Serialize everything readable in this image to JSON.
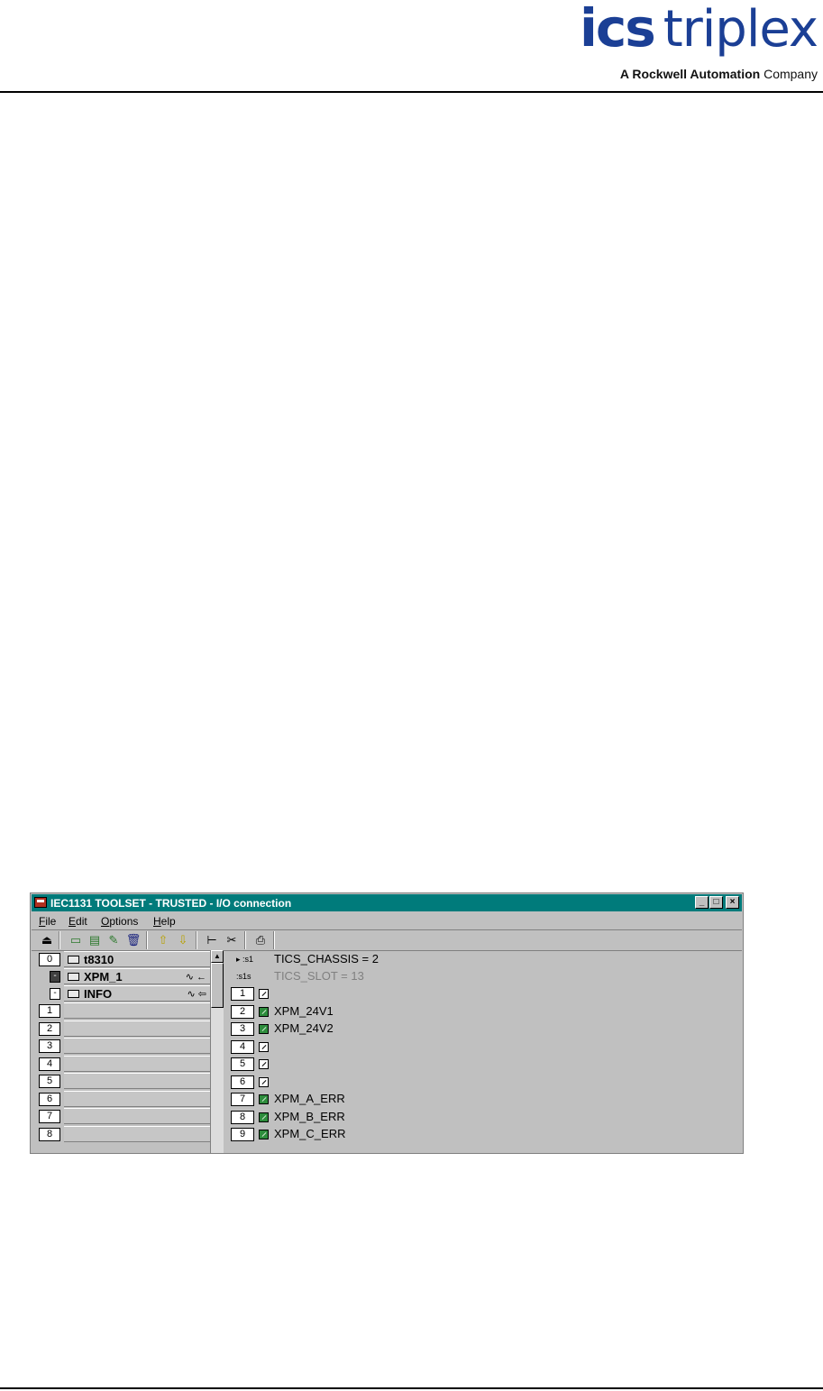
{
  "header": {
    "logo_ics": "ics",
    "logo_triplex": "triplex",
    "logo_subtitle_bold": "A Rockwell Automation",
    "logo_subtitle_normal": "Company",
    "brand_color": "#1b3f95"
  },
  "window": {
    "title": "IEC1131 TOOLSET - TRUSTED - I/O connection",
    "titlebar_color": "#007b7b",
    "controls": {
      "minimize": "_",
      "maximize": "□",
      "close": "×"
    }
  },
  "menu": {
    "items": [
      {
        "accel": "F",
        "rest": "ile"
      },
      {
        "accel": "E",
        "rest": "dit"
      },
      {
        "accel": "O",
        "rest": "ptions"
      },
      {
        "accel": "H",
        "rest": "elp"
      }
    ]
  },
  "toolbar": {
    "buttons": [
      "open-icon",
      "insert-board-icon",
      "add-board-icon",
      "edit-board-icon",
      "delete-icon",
      "move-up-icon",
      "move-down-icon",
      "tree-icon",
      "cut-icon",
      "print-icon"
    ],
    "glyphs": [
      "⏏",
      "▭",
      "▤",
      "✎",
      "🗑",
      "⇧",
      "⇩",
      "⊢",
      "✂",
      "⎙"
    ]
  },
  "left_tree": {
    "rows": [
      {
        "slot": "0",
        "label": "t8310",
        "sym": ""
      },
      {
        "slot": "-",
        "label": "XPM_1",
        "sym": "∿ ←"
      },
      {
        "slot": "-",
        "label": "INFO",
        "sym": "∿ ⇦"
      },
      {
        "slot": "1",
        "label": "",
        "sym": ""
      },
      {
        "slot": "2",
        "label": "",
        "sym": ""
      },
      {
        "slot": "3",
        "label": "",
        "sym": ""
      },
      {
        "slot": "4",
        "label": "",
        "sym": ""
      },
      {
        "slot": "5",
        "label": "",
        "sym": ""
      },
      {
        "slot": "6",
        "label": "",
        "sym": ""
      },
      {
        "slot": "7",
        "label": "",
        "sym": ""
      },
      {
        "slot": "8",
        "label": "",
        "sym": ""
      }
    ]
  },
  "right_list": {
    "header_rows": [
      {
        "icon": "▸ :s1",
        "label": "TICS_CHASSIS = 2",
        "dim": false
      },
      {
        "icon": ":s1s",
        "label": "TICS_SLOT = 13",
        "dim": true
      }
    ],
    "channels": [
      {
        "num": "1",
        "label": "",
        "connected": false
      },
      {
        "num": "2",
        "label": "XPM_24V1",
        "connected": true
      },
      {
        "num": "3",
        "label": "XPM_24V2",
        "connected": true
      },
      {
        "num": "4",
        "label": "",
        "connected": false
      },
      {
        "num": "5",
        "label": "",
        "connected": false
      },
      {
        "num": "6",
        "label": "",
        "connected": false
      },
      {
        "num": "7",
        "label": "XPM_A_ERR",
        "connected": true
      },
      {
        "num": "8",
        "label": "XPM_B_ERR",
        "connected": true
      },
      {
        "num": "9",
        "label": "XPM_C_ERR",
        "connected": true
      }
    ]
  }
}
